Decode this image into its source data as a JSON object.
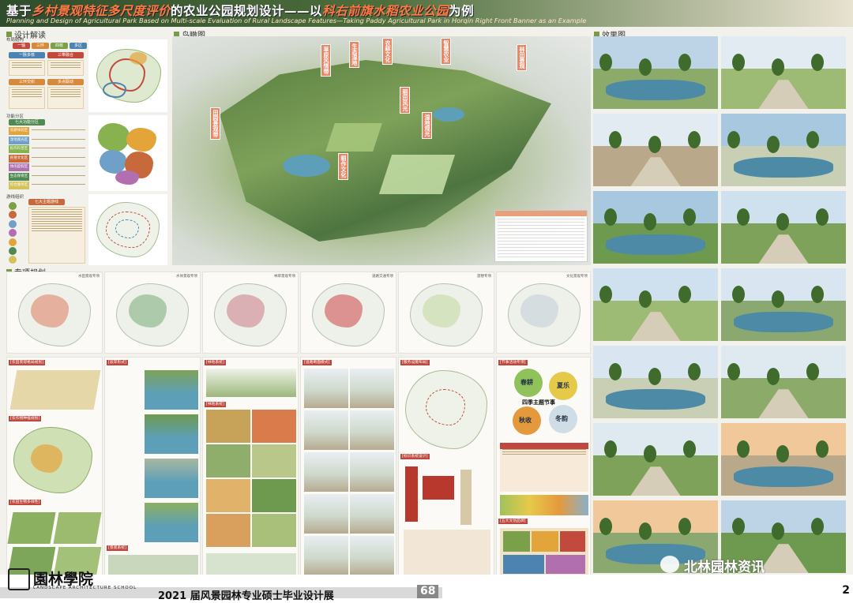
{
  "header": {
    "title_prefix": "基于",
    "title_highlight_1": "乡村景观特征多尺度评价",
    "title_mid": "的农业公园规划设计——以",
    "title_highlight_2": "科右前旗水稻农业公园",
    "title_suffix": "为例",
    "title_en": "Planning and Design of Agricultural Park Based on Multi-scale Evaluation of Rural Landscape Features—Taking Paddy Agricultural Park in Horqin Right Front Banner as an Example"
  },
  "sections": {
    "design": "设计解读",
    "aerial": "鸟瞰图",
    "renders": "效果图",
    "special": "专项规划"
  },
  "left": {
    "layout_label": "布局结构",
    "zone_label": "功能分区",
    "node_label": "游线组织",
    "structure_items": [
      "一轴",
      "三环",
      "四核",
      "多区"
    ],
    "card_a": "一脉多核",
    "card_b": "三带融合",
    "card_c": "三环交织",
    "card_d": "多点联动",
    "zone_header": "七大功能分区",
    "node_header": "七大主题游线",
    "zones": [
      "农耕体验区",
      "湿地观光区",
      "稻作科普区",
      "民俗文化区",
      "休闲度假区",
      "生态保育区",
      "综合服务区"
    ],
    "zone_colors": [
      "#e3a43a",
      "#6fa0c8",
      "#87b24d",
      "#c8693c",
      "#b26fb0",
      "#4e8a52",
      "#d4c25a"
    ]
  },
  "aerial": {
    "callouts": [
      "田园景观带",
      "草原风情带",
      "生态湿地",
      "农耕文化",
      "智慧农业",
      "林田景观",
      "稻田风光",
      "湿地观光",
      "稻作文化"
    ]
  },
  "renders": {
    "count": 14
  },
  "special": {
    "cards": [
      "水田景观专项",
      "水体景观专项",
      "林草景观专项",
      "道路交通专项",
      "游憩专项",
      "文化景观专项"
    ],
    "sub_titles": [
      "[农田景观格局规划]",
      "[驳岸形式]",
      "[林地系统]",
      "[道路断面模式]",
      "[服务设施布局]",
      "[节事活动专项]"
    ],
    "sub_titles_2": [
      "[农作物种植规划]",
      "[林地系统]",
      "[标识系统设计]",
      "[五大文创品牌]"
    ],
    "sub_titles_3": [
      "[农田生物多样性]",
      "[景观系统]",
      "[驳岸形式]"
    ],
    "festival": {
      "spring": "春耕",
      "summer": "夏乐",
      "autumn": "秋收",
      "winter": "冬韵",
      "center": "四季主题节事"
    }
  },
  "footer": {
    "logo": "園林學院",
    "logo_sub": "LANDSCAPE ARCHITECTURE SCHOOL",
    "text": "2021 届风景园林专业硕士毕业设计展",
    "number": "68",
    "watermark": "北林园林资讯",
    "page": "2"
  }
}
